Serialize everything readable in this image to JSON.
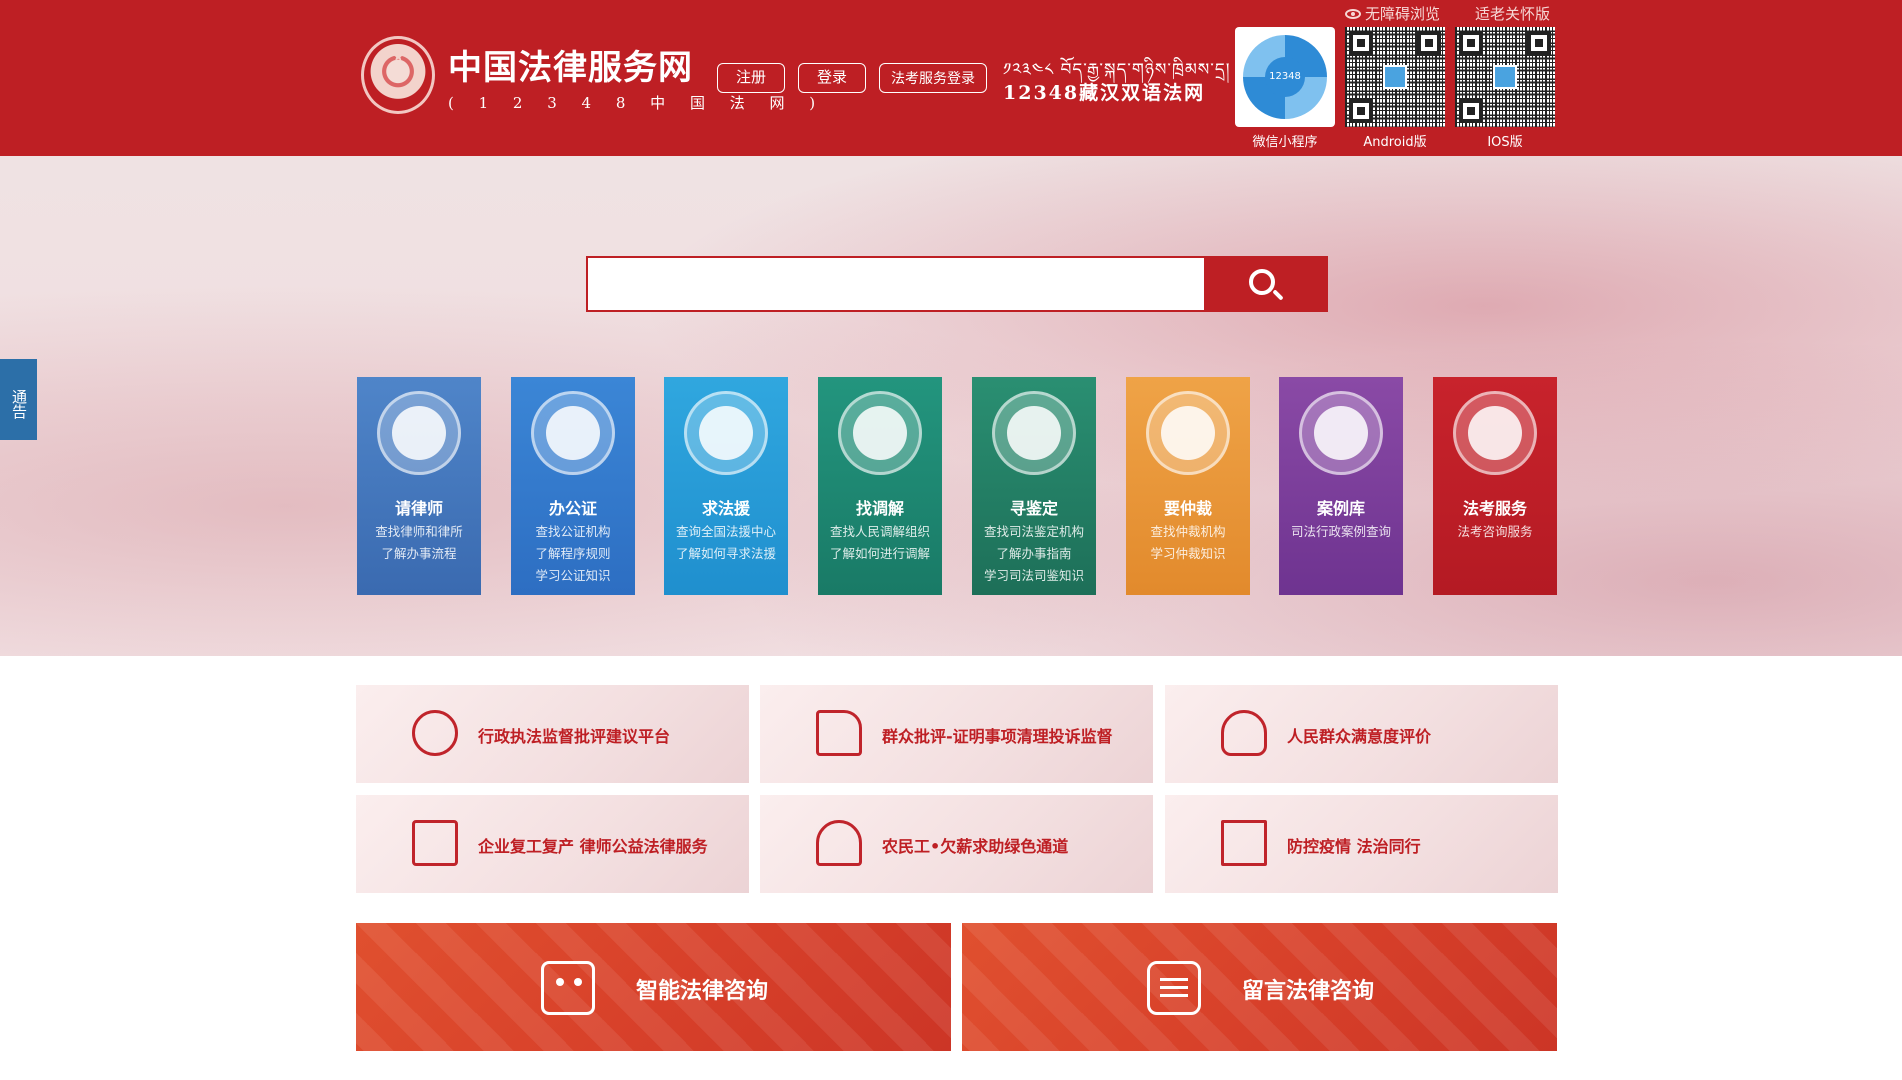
{
  "header": {
    "logo_title": "中国法律服务网",
    "logo_subtitle": "( 1 2 3 4 8 中 国 法 网 )",
    "register_label": "注册",
    "login_label": "登录",
    "exam_login_label": "法考服务登录",
    "tibetan_text": "༡༢༣༤༨ བོད་རྒྱ་སྐད་གཉིས་ཁྲིམས་དྲ།",
    "bilingual_label": "12348藏汉双语法网",
    "accessibility_label": "无障碍浏览",
    "elder_label": "适老关怀版",
    "qr_codes": [
      {
        "label": "微信小程序",
        "icon": "wechat-miniprogram-qr"
      },
      {
        "label": "Android版",
        "icon": "android-qr"
      },
      {
        "label": "IOS版",
        "icon": "ios-qr"
      }
    ],
    "qr_center_text": "12348"
  },
  "search": {
    "value": "",
    "placeholder": ""
  },
  "notice_tab": "通告",
  "tiles": [
    {
      "name": "请律师",
      "desc": [
        "查找律师和律所",
        "了解办事流程"
      ],
      "color": "#4f85c9"
    },
    {
      "name": "办公证",
      "desc": [
        "查找公证机构",
        "了解程序规则",
        "学习公证知识"
      ],
      "color": "#3b86d6"
    },
    {
      "name": "求法援",
      "desc": [
        "查询全国法援中心",
        "了解如何寻求法援"
      ],
      "color": "#30a7df"
    },
    {
      "name": "找调解",
      "desc": [
        "查找人民调解组织",
        "了解如何进行调解"
      ],
      "color": "#23957e"
    },
    {
      "name": "寻鉴定",
      "desc": [
        "查找司法鉴定机构",
        "了解办事指南",
        "学习司法司鉴知识"
      ],
      "color": "#2a8f72"
    },
    {
      "name": "要仲裁",
      "desc": [
        "查找仲裁机构",
        "学习仲裁知识"
      ],
      "color": "#efa347"
    },
    {
      "name": "案例库",
      "desc": [
        "司法行政案例查询"
      ],
      "color": "#8a4aa6"
    },
    {
      "name": "法考服务",
      "desc": [
        "法考咨询服务"
      ],
      "color": "#c8232c"
    }
  ],
  "service_cards": [
    {
      "label": "行政执法监督批评建议平台",
      "icon": "monitor-icon"
    },
    {
      "label": "群众批评-证明事项清理投诉监督",
      "icon": "thumbs-up-icon"
    },
    {
      "label": "人民群众满意度评价",
      "icon": "person-heart-icon"
    },
    {
      "label": "企业复工复产 律师公益法律服务",
      "icon": "document-search-icon"
    },
    {
      "label": "农民工•欠薪求助绿色通道",
      "icon": "worker-icon"
    },
    {
      "label": "防控疫情 法治同行",
      "icon": "form-edit-icon"
    }
  ],
  "consult": {
    "smart_label": "智能法律咨询",
    "message_label": "留言法律咨询"
  },
  "colors": {
    "brand_red": "#be1f24",
    "notice_blue": "#2c6fa8",
    "consult_orange": "#d8412a"
  }
}
